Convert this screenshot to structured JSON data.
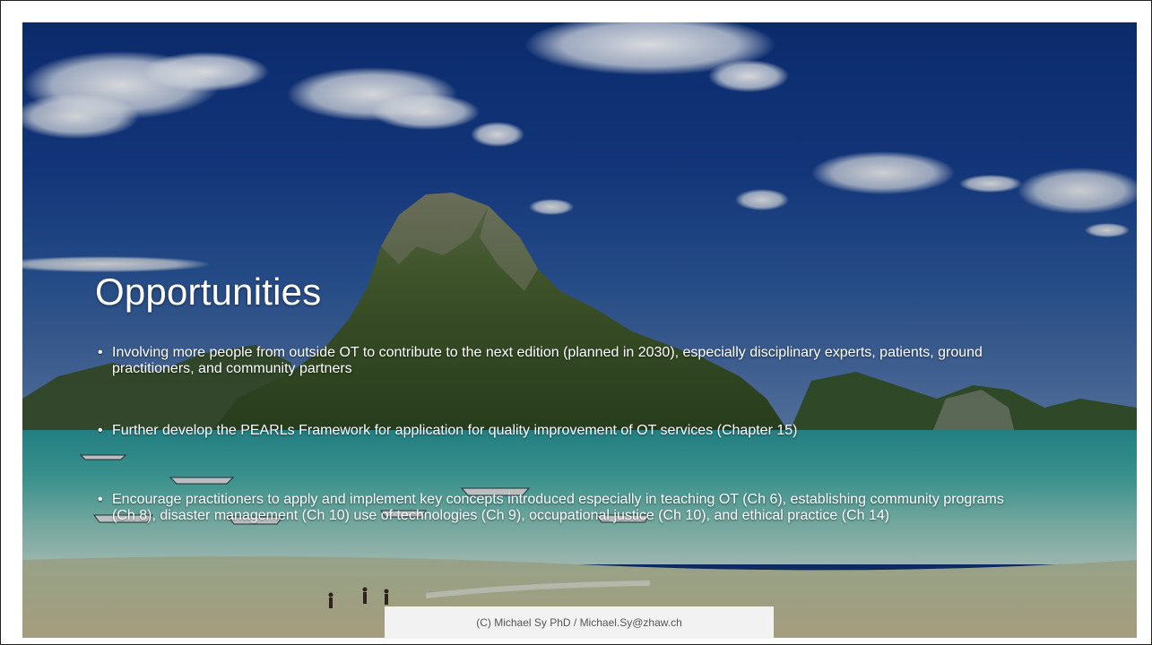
{
  "slide": {
    "title": "Opportunities",
    "bullets": [
      "Involving more people from outside OT to contribute to the next edition (planned in 2030), especially disciplinary experts, patients, ground practitioners, and community partners",
      "Further develop the PEARLs Framework for application for quality improvement of OT services (Chapter 15)",
      "Encourage practitioners to apply and implement key concepts introduced especially in teaching OT (Ch 6), establishing community programs (Ch 8), disaster management (Ch 10) use of technologies (Ch 9), occupational justice (Ch 10), and ethical practice (Ch 14)"
    ],
    "footer": "(C) Michael Sy PhD / Michael.Sy@zhaw.ch"
  }
}
